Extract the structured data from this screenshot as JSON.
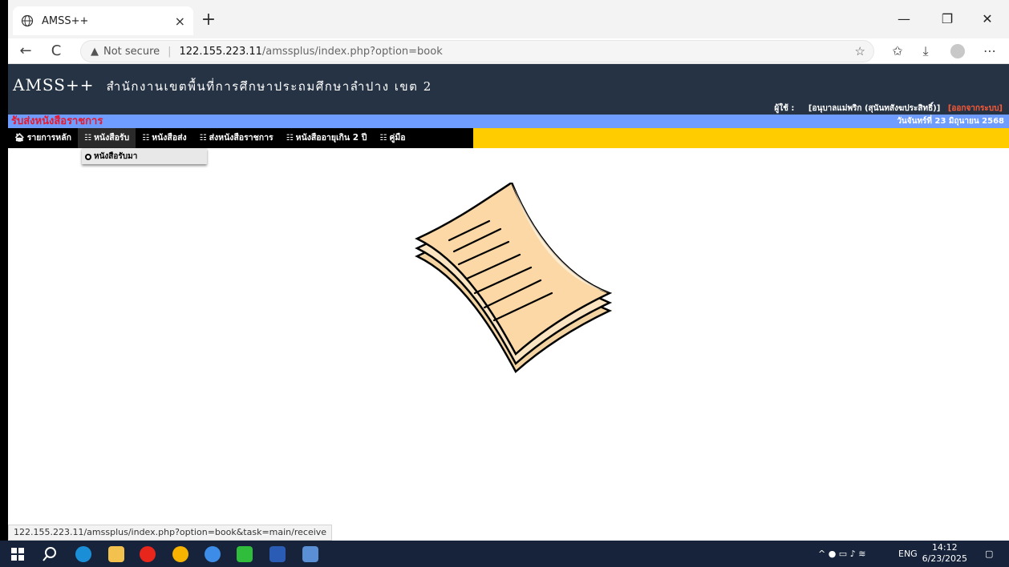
{
  "browser": {
    "tab_title": "AMSS++",
    "tab_close": "×",
    "new_tab": "+",
    "win_min": "—",
    "win_max": "❐",
    "win_close": "✕",
    "back": "←",
    "reload": "C",
    "security_label": "Not secure",
    "url_host": "122.155.223.11",
    "url_path": "/amssplus/index.php?option=book"
  },
  "site": {
    "brand": "AMSS++",
    "office": "สำนักงานเขตพื้นที่การศึกษาประถมศึกษาลำปาง เขต 2",
    "user_label": "ผู้ใช้ :",
    "user_name": "[อนุบาลแม่พริก (สุนันทสังฆประสิทธิ์)]",
    "logout": "[ออกจากระบบ]",
    "section_title": "รับส่งหนังสือราชการ",
    "date": "วันจันทร์ที่ 23 มิถุนายน 2568"
  },
  "menu": {
    "items": [
      {
        "label": "รายการหลัก",
        "icon": "home-icon"
      },
      {
        "label": "หนังสือรับ",
        "icon": "grid-icon"
      },
      {
        "label": "หนังสือส่ง",
        "icon": "grid-icon"
      },
      {
        "label": "ส่งหนังสือราชการ",
        "icon": "grid-icon"
      },
      {
        "label": "หนังสืออายุเกิน 2 ปี",
        "icon": "grid-icon"
      },
      {
        "label": "คู่มือ",
        "icon": "grid-icon"
      }
    ],
    "dropdown_item": "หนังสือรับมา"
  },
  "status_url": "122.155.223.11/amssplus/index.php?option=book&task=main/receive",
  "taskbar": {
    "lang": "ENG",
    "time": "14:12",
    "date": "6/23/2025"
  },
  "colors": {
    "header_bg": "#253344",
    "subbar_bg": "#6f9dff",
    "menu_bg": "#ffcc00",
    "section_title": "#e8192c",
    "logout": "#ff5a36"
  }
}
